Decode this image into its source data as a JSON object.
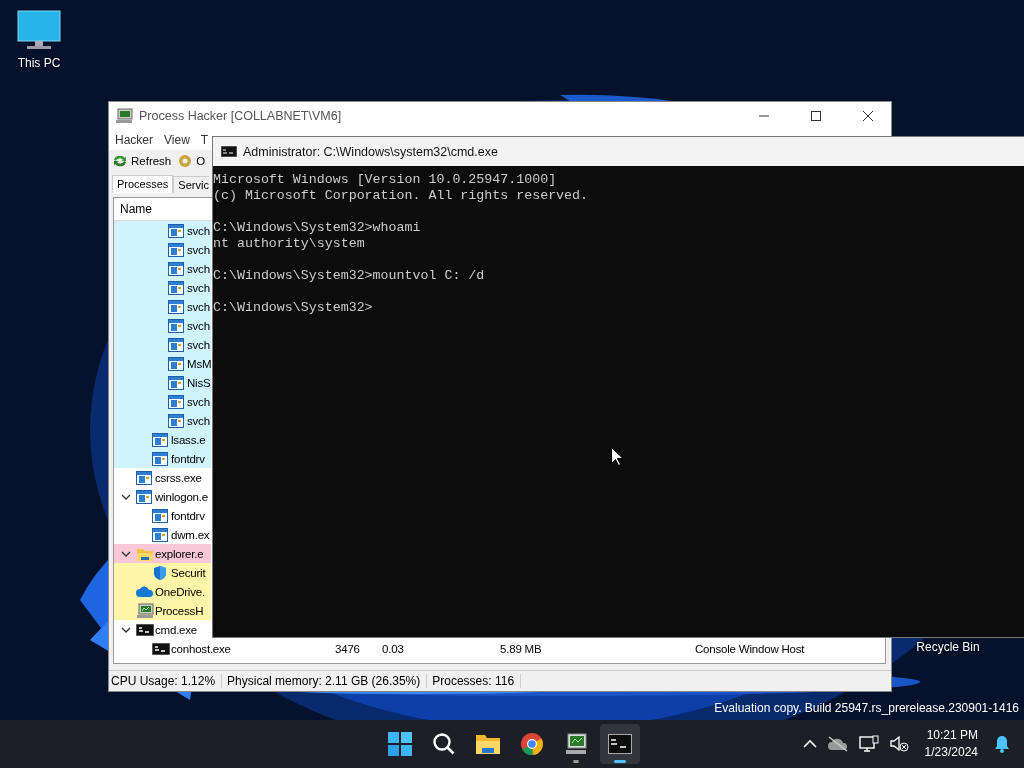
{
  "desktop_icons": [
    {
      "label": "This PC",
      "kind": "computer"
    },
    {
      "label": "Recycle Bin",
      "kind": "bin"
    }
  ],
  "process_hacker": {
    "title": "Process Hacker [COLLABNET\\VM6]",
    "menu": [
      "Hacker",
      "View",
      "T"
    ],
    "toolbar": [
      "Refresh",
      "O"
    ],
    "tabs": [
      {
        "label": "Processes",
        "selected": true
      },
      {
        "label": "Servic",
        "selected": false
      }
    ],
    "columns": [
      "Name"
    ],
    "tree": [
      {
        "children": [
          {
            "children": [
              {
                "name": "svch",
                "kind": "app",
                "color": "#d0f4fc"
              },
              {
                "name": "svch",
                "kind": "app",
                "color": "#d0f4fc"
              },
              {
                "name": "svch",
                "kind": "app",
                "color": "#d0f4fc"
              },
              {
                "name": "svch",
                "kind": "app",
                "color": "#d0f4fc"
              },
              {
                "name": "svch",
                "kind": "app",
                "color": "#d0f4fc"
              },
              {
                "name": "svch",
                "kind": "app",
                "color": "#d0f4fc"
              },
              {
                "name": "svch",
                "kind": "app",
                "color": "#d0f4fc"
              },
              {
                "name": "MsM",
                "kind": "app",
                "color": "#d0f4fc"
              },
              {
                "name": "NisS",
                "kind": "app",
                "color": "#d0f4fc"
              },
              {
                "name": "svch",
                "kind": "app",
                "color": "#d0f4fc"
              },
              {
                "name": "svch",
                "kind": "app",
                "color": "#d0f4fc"
              }
            ]
          },
          {
            "name": "lsass.e",
            "kind": "app",
            "color": "#d0f4fc"
          },
          {
            "name": "fontdrv",
            "kind": "app",
            "color": "#d0f4fc"
          }
        ]
      },
      {
        "name": "csrss.exe",
        "kind": "app",
        "color": "#ffffff"
      },
      {
        "name": "winlogon.e",
        "kind": "app",
        "color": "#ffffff",
        "expanded": true,
        "children": [
          {
            "name": "fontdrv",
            "kind": "app",
            "color": "#ffffff"
          },
          {
            "name": "dwm.ex",
            "kind": "app",
            "color": "#ffffff"
          }
        ]
      },
      {
        "name": "explorer.e",
        "kind": "folder",
        "color": "#f8c8d8",
        "expanded": true,
        "children": [
          {
            "name": "Securit",
            "kind": "shield",
            "color": "#fdf6a8"
          }
        ]
      },
      {
        "name": "OneDrive.",
        "kind": "cloud",
        "color": "#fdf6a8"
      },
      {
        "name": "ProcessH",
        "kind": "monitor",
        "color": "#fdf6a8"
      },
      {
        "name": "cmd.exe",
        "kind": "console",
        "color": "#ffffff",
        "expanded": true,
        "children": [
          {
            "name": "conhost.exe",
            "kind": "console",
            "color": "#ffffff",
            "pid": "3476",
            "cpu": "0.03",
            "memory": "5.89 MB",
            "description": "Console Window Host"
          }
        ]
      }
    ],
    "status_bar": [
      "CPU Usage: 1.12%",
      "Physical memory: 2.11 GB (26.35%)",
      "Processes: 116"
    ]
  },
  "cmd_window": {
    "title": "Administrator: C:\\Windows\\system32\\cmd.exe",
    "blocks": [
      [
        "Microsoft Windows [Version 10.0.25947.1000]",
        "(c) Microsoft Corporation. All rights reserved."
      ],
      [
        "C:\\Windows\\System32>whoami",
        "nt authority\\system"
      ],
      [
        "C:\\Windows\\System32>mountvol C: /d"
      ],
      [
        "C:\\Windows\\System32>"
      ]
    ]
  },
  "watermark_text": "Evaluation copy. Build 25947.rs_prerelease.230901-1416",
  "taskbar": {
    "apps": [
      {
        "kind": "start",
        "running": false,
        "selected": false
      },
      {
        "kind": "search",
        "running": false,
        "selected": false
      },
      {
        "kind": "files",
        "running": false,
        "selected": false
      },
      {
        "kind": "browser",
        "running": false,
        "selected": false
      },
      {
        "kind": "monitor",
        "running": true,
        "selected": false
      },
      {
        "kind": "console",
        "running": true,
        "selected": true
      }
    ],
    "time": "10:21 PM",
    "date": "1/23/2024"
  }
}
